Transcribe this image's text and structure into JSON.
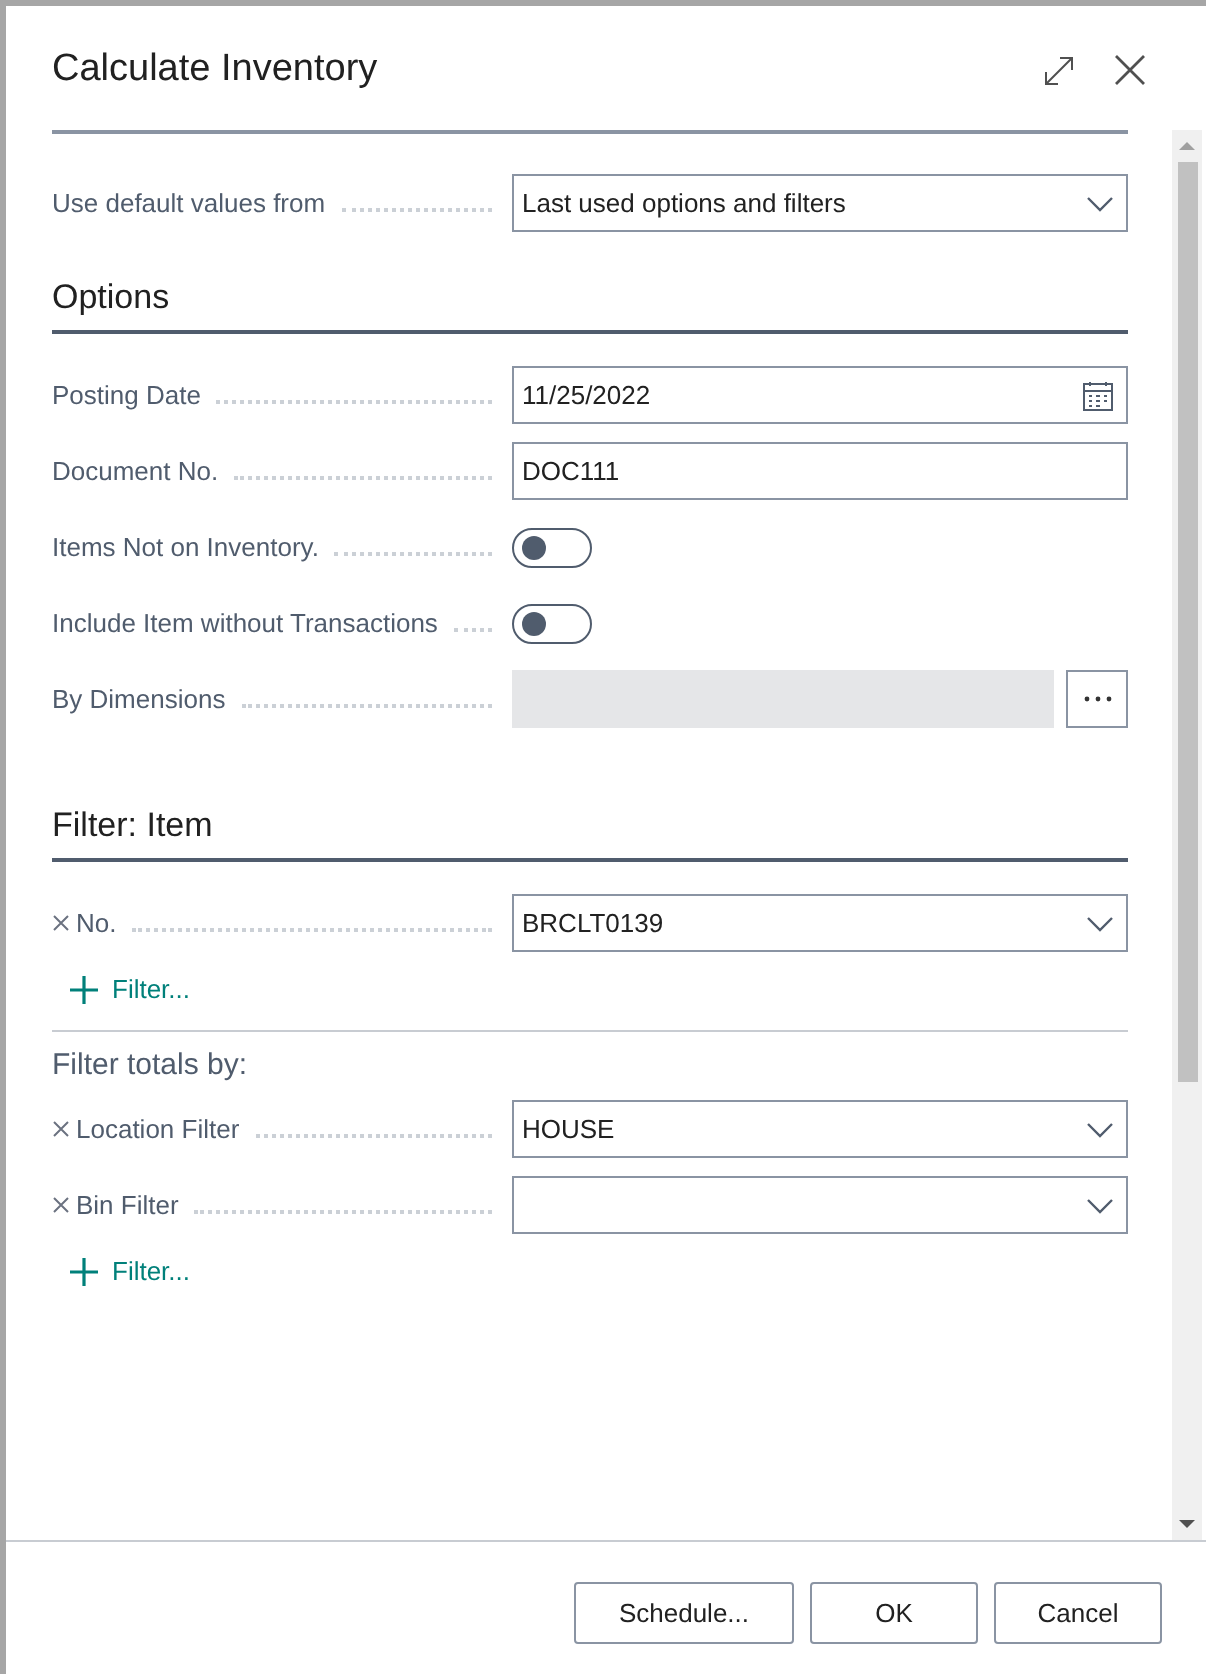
{
  "window": {
    "title": "Calculate Inventory"
  },
  "default_values": {
    "label": "Use default values from",
    "kind": "select",
    "value": "Last used options and filters"
  },
  "sections": [
    {
      "heading": "Options",
      "groups": [
        {
          "fields": [
            {
              "label": "Posting Date",
              "kind": "date",
              "value": "11/25/2022",
              "removable": false
            },
            {
              "label": "Document No.",
              "kind": "text",
              "value": "DOC111",
              "removable": false
            },
            {
              "label": "Items Not on Inventory.",
              "kind": "toggle",
              "on": false,
              "removable": false
            },
            {
              "label": "Include Item without Transactions",
              "kind": "toggle",
              "on": false,
              "removable": false
            },
            {
              "label": "By Dimensions",
              "kind": "lookup",
              "removable": false
            }
          ]
        }
      ]
    },
    {
      "heading": "Filter: Item",
      "groups": [
        {
          "fields": [
            {
              "label": "No.",
              "kind": "select",
              "value": "BRCLT0139",
              "removable": true
            }
          ],
          "add_filter": "Filter..."
        },
        {
          "caption": "Filter totals by:",
          "fields": [
            {
              "label": "Location Filter",
              "kind": "select",
              "value": "HOUSE",
              "removable": true
            },
            {
              "label": "Bin Filter",
              "kind": "select",
              "removable": true
            }
          ],
          "add_filter": "Filter..."
        }
      ]
    }
  ],
  "buttons": [
    "Schedule...",
    "OK",
    "Cancel"
  ]
}
